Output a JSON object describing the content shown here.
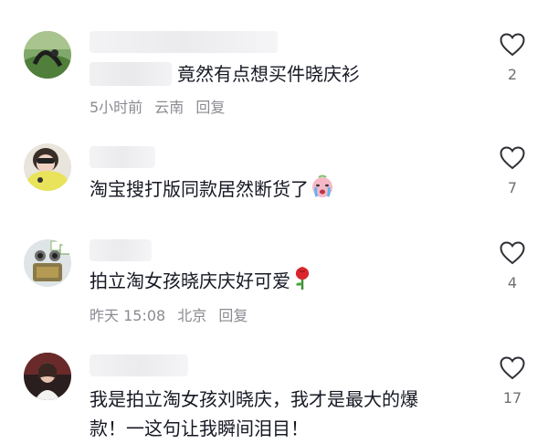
{
  "comments": [
    {
      "text": "竟然有点想买件晓庆衫",
      "time": "5小时前",
      "location": "云南",
      "reply": "回复",
      "likes": "2"
    },
    {
      "text": "淘宝搜打版同款居然断货了",
      "likes": "7"
    },
    {
      "text": "拍立淘女孩晓庆庆好可爱",
      "time": "昨天 15:08",
      "location": "北京",
      "reply": "回复",
      "likes": "4"
    },
    {
      "text_line1": "我是拍立淘女孩刘晓庆，我才是最大的爆",
      "text_line2": "款！一这句让我瞬间泪目！",
      "likes": "17"
    }
  ],
  "icons": {
    "like": "heart-outline-icon",
    "emoji_cry": "crying-face-emoji",
    "emoji_rose": "rose-emoji"
  },
  "colors": {
    "text": "#161823",
    "meta": "#8a8b91",
    "icon": "#2f3036"
  }
}
